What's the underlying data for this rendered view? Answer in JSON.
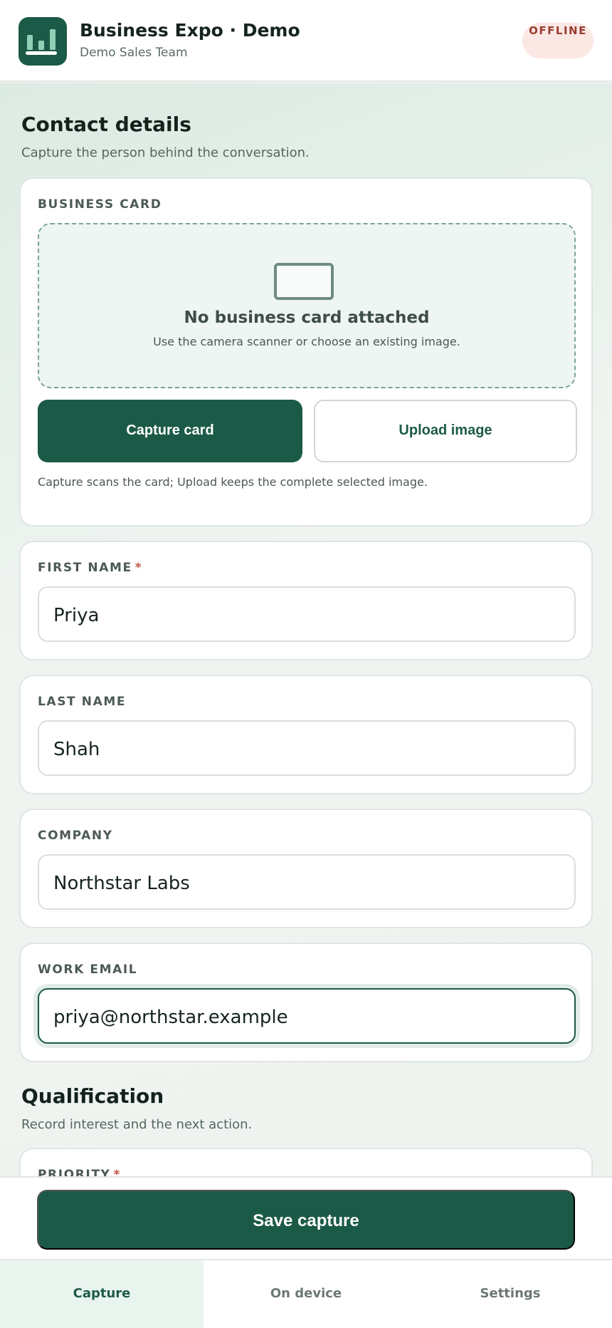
{
  "header": {
    "title": "Business Expo · Demo",
    "subtitle": "Demo Sales Team",
    "status_badge": "OFFLINE",
    "logo_icon": "bar-chart-icon"
  },
  "contact": {
    "title": "Contact details",
    "subtitle": "Capture the person behind the conversation."
  },
  "business_card": {
    "label": "BUSINESS CARD",
    "empty_title": "No business card attached",
    "empty_hint": "Use the camera scanner or choose an existing image.",
    "icon": "card-icon",
    "capture_button": "Capture card",
    "upload_button": "Upload image",
    "help": "Capture scans the card; Upload keeps the complete selected image."
  },
  "fields": {
    "first_name": {
      "label": "FIRST NAME",
      "required_mark": "*",
      "value": "Priya"
    },
    "last_name": {
      "label": "LAST NAME",
      "value": "Shah"
    },
    "company": {
      "label": "COMPANY",
      "value": "Northstar Labs"
    },
    "work_email": {
      "label": "WORK EMAIL",
      "value": "priya@northstar.example"
    }
  },
  "qualification": {
    "title": "Qualification",
    "subtitle": "Record interest and the next action.",
    "priority_label": "PRIORITY",
    "priority_required_mark": "*"
  },
  "actions": {
    "save": "Save capture"
  },
  "tabs": [
    {
      "label": "Capture",
      "active": true
    },
    {
      "label": "On device",
      "active": false
    },
    {
      "label": "Settings",
      "active": false
    }
  ],
  "colors": {
    "accent": "#1c5a48",
    "offline_badge_bg": "#fbe7e3",
    "offline_badge_text": "#9a3d32",
    "required": "#c0533f"
  }
}
